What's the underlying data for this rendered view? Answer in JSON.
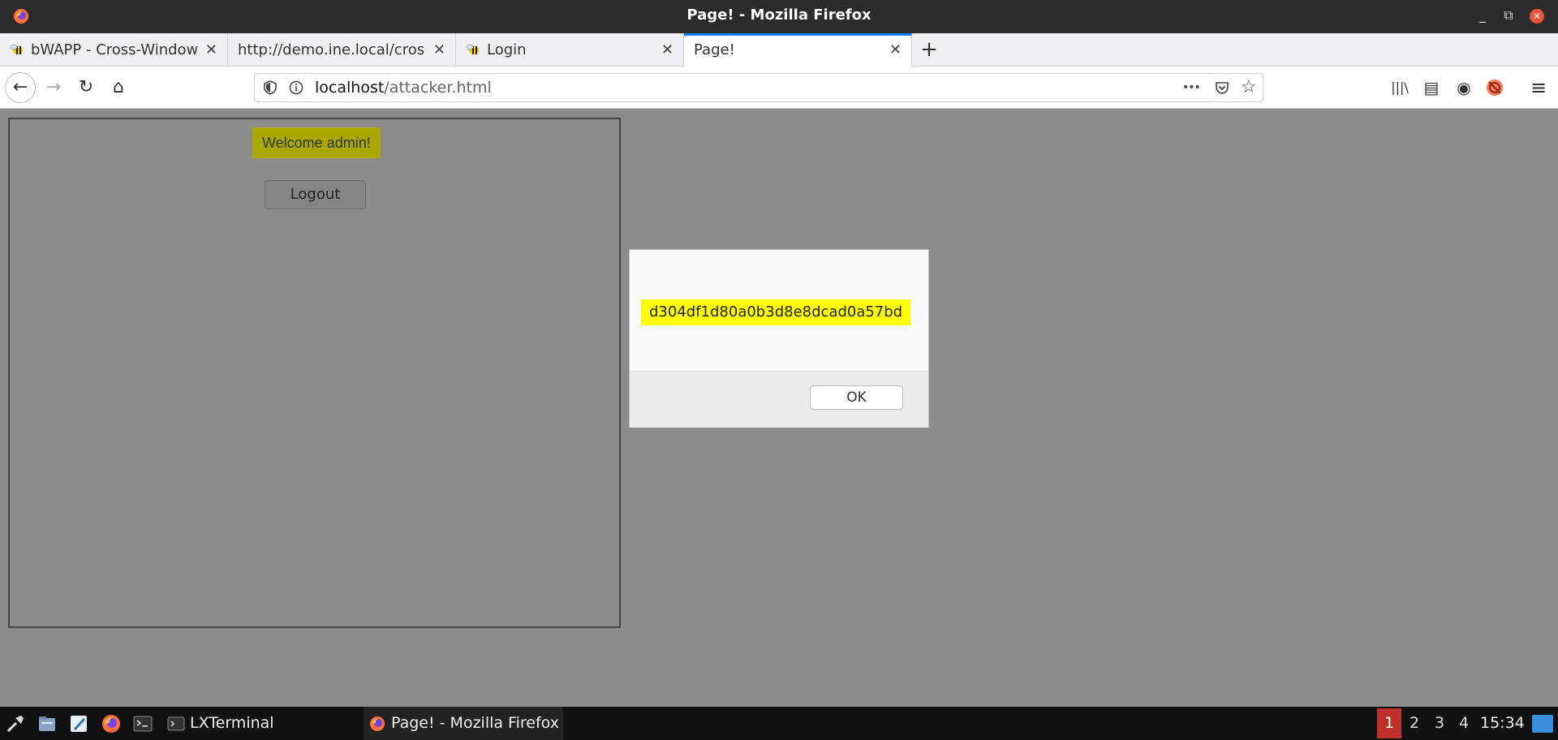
{
  "window": {
    "title": "Page! - Mozilla Firefox",
    "min_glyph": "_",
    "max_glyph": "⧉",
    "close_glyph": "✕"
  },
  "tabs": [
    {
      "label": "bWAPP - Cross-Window",
      "icon": "bee-icon",
      "active": false,
      "close": "✕"
    },
    {
      "label": "http://demo.ine.local/cros",
      "icon": null,
      "active": false,
      "close": "✕"
    },
    {
      "label": "Login",
      "icon": "bee-icon",
      "active": false,
      "close": "✕"
    },
    {
      "label": "Page!",
      "icon": null,
      "active": true,
      "close": "✕"
    }
  ],
  "newtab_glyph": "+",
  "nav": {
    "back": "←",
    "forward": "→",
    "reload": "↻",
    "home": "⌂",
    "url_host": "localhost",
    "url_path": "/attacker.html",
    "more": "•••",
    "pocket": "◇",
    "star": "☆",
    "library": "|||\\",
    "sidebar": "▤",
    "account": "◉",
    "menu": "≡"
  },
  "frame": {
    "welcome": "Welcome admin!",
    "logout": "Logout"
  },
  "dialog": {
    "message": "d304df1d80a0b3d8e8dcad0a57bd",
    "ok": "OK"
  },
  "taskbar": {
    "apps": [
      {
        "label": "LXTerminal"
      },
      {
        "label": "Page! - Mozilla Firefox"
      }
    ],
    "workspaces": [
      "1",
      "2",
      "3",
      "4"
    ],
    "active_workspace": "1",
    "clock": "15:34"
  },
  "colors": {
    "accent": "#0a84ff",
    "alert_highlight": "#ffff00",
    "welcome_bg": "#a8a800",
    "page_bg": "#8c8c8c",
    "workspace_active": "#c0302a"
  }
}
